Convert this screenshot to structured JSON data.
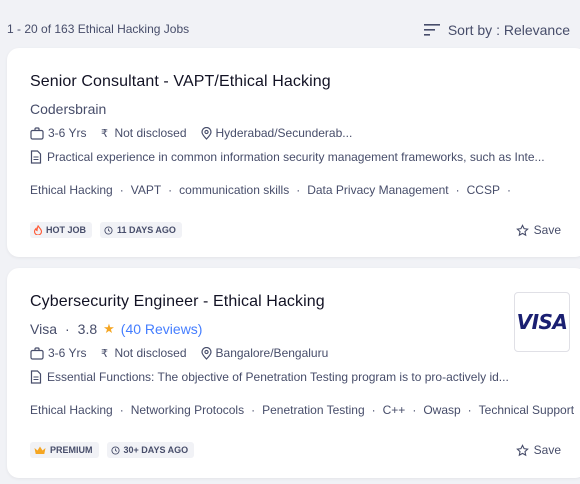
{
  "header": {
    "results_count": "1 - 20 of 163",
    "results_query": "Ethical Hacking Jobs",
    "sort_label": "Sort by : Relevance"
  },
  "jobs": [
    {
      "title": "Senior Consultant - VAPT/Ethical Hacking",
      "company": "Codersbrain",
      "experience": "3-6 Yrs",
      "salary": "Not disclosed",
      "location": "Hyderabad/Secunderab...",
      "description": "Practical experience in common information security management frameworks, such as Inte...",
      "tags": [
        "Ethical Hacking",
        "VAPT",
        "communication skills",
        "Data Privacy Management",
        "CCSP"
      ],
      "badge": "HOT JOB",
      "posted": "11 DAYS AGO",
      "save_label": "Save"
    },
    {
      "title": "Cybersecurity Engineer - Ethical Hacking",
      "company": "Visa",
      "rating": "3.8",
      "reviews": "(40 Reviews)",
      "logo_text": "VISA",
      "experience": "3-6 Yrs",
      "salary": "Not disclosed",
      "location": "Bangalore/Bengaluru",
      "description": "Essential Functions: The objective of Penetration Testing program is to pro-actively id...",
      "tags": [
        "Ethical Hacking",
        "Networking Protocols",
        "Penetration Testing",
        "C++",
        "Owasp",
        "Technical Support"
      ],
      "badge": "PREMIUM",
      "posted": "30+ DAYS AGO",
      "save_label": "Save"
    }
  ],
  "colors": {
    "background": "#f1f2f6",
    "card": "#ffffff",
    "text_primary": "#121224",
    "text_secondary": "#474d6a",
    "link": "#457eff",
    "star": "#f5a623",
    "hot_icon": "#ff5a36",
    "premium_icon": "#f5a623",
    "visa_blue": "#1a1f71"
  }
}
